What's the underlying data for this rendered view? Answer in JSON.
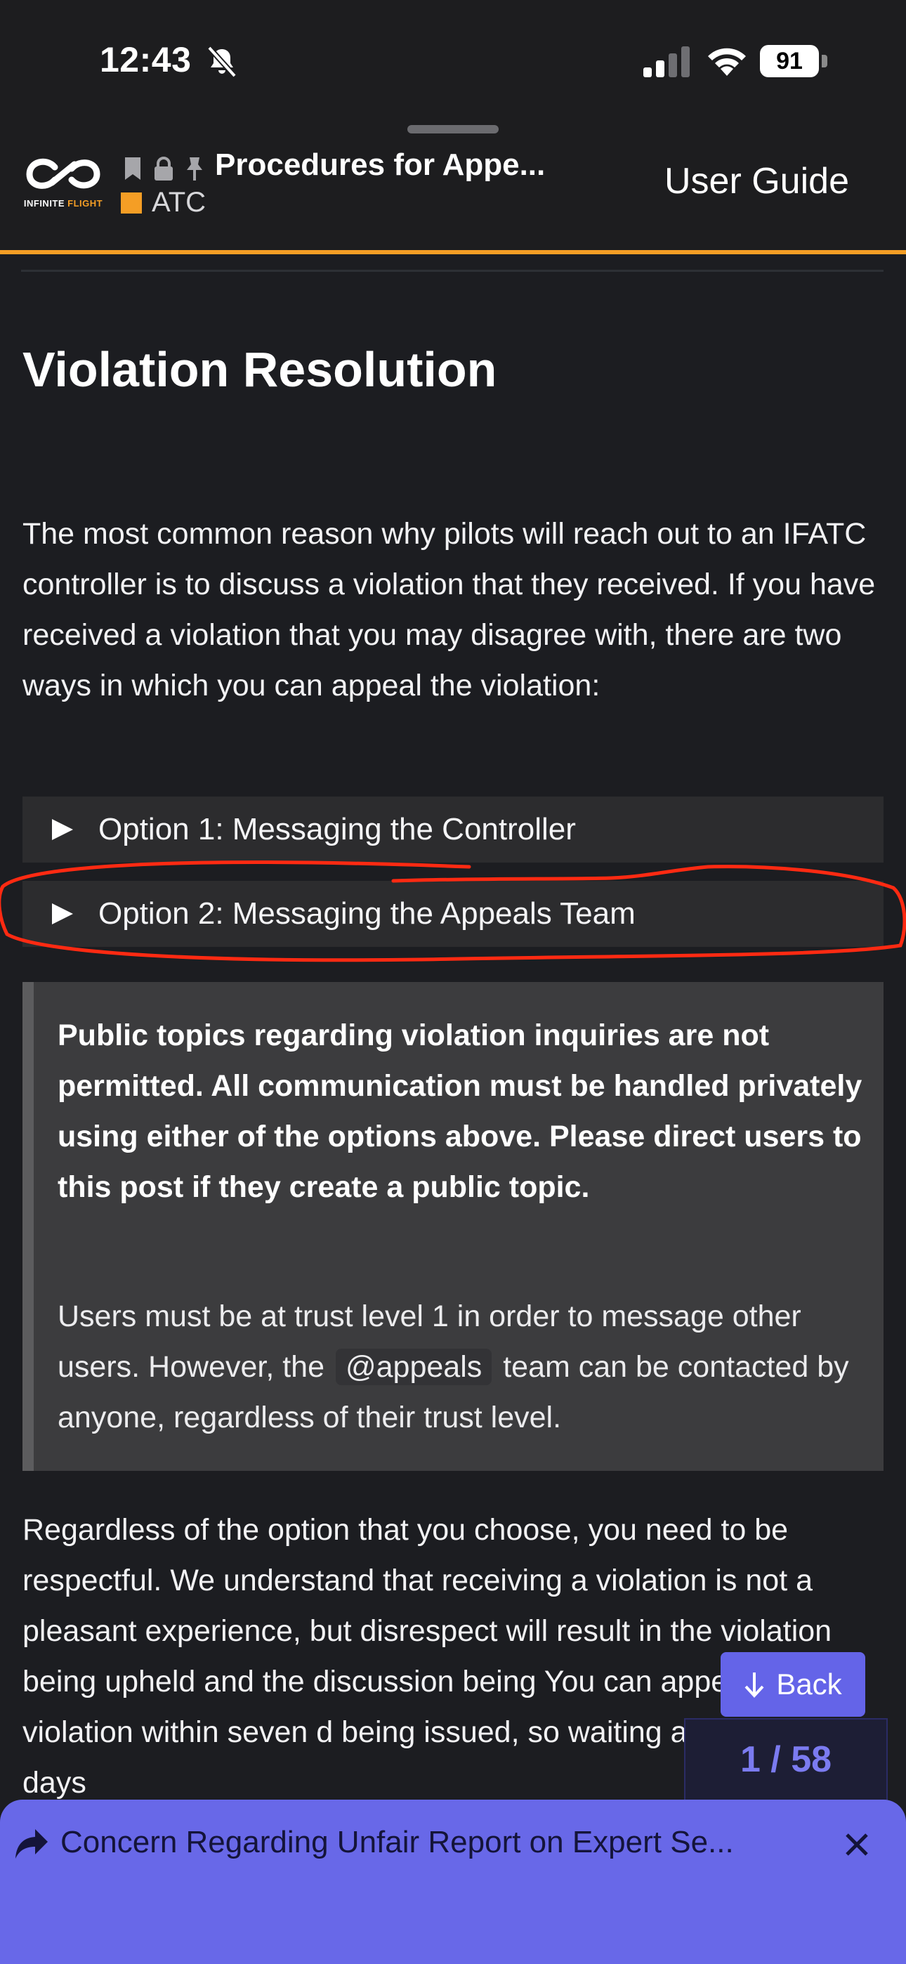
{
  "status_bar": {
    "time": "12:43",
    "battery": "91",
    "icons": [
      "bell-slash-icon",
      "cellular-signal-icon",
      "wifi-icon",
      "battery-icon"
    ]
  },
  "header": {
    "logo": {
      "word": "INFINITE",
      "accent": "FLIGHT",
      "accent_color": "#f59e25"
    },
    "topic_icons": [
      "bookmark-icon",
      "lock-icon",
      "pin-icon"
    ],
    "title": "Procedures for Appe...",
    "category": {
      "name": "ATC",
      "color": "#f59e25"
    },
    "user_guide_label": "User Guide"
  },
  "content": {
    "heading": "Violation Resolution",
    "intro": "The most common reason why pilots will reach out to an IFATC controller is to discuss a violation that they received. If you have received a violation that you may disagree with, there are two ways in which you can appeal the violation:",
    "options": [
      {
        "label": "Option 1: Messaging the Controller"
      },
      {
        "label": "Option 2: Messaging the Appeals Team"
      }
    ],
    "callout": {
      "strong": "Public topics regarding violation inquiries are not permitted. All communication must be handled privately using either of the options above. Please direct users to this post if they create a public topic.",
      "body_before": "Users must be at trust level 1 in order to message other users. However, the",
      "mention": "@appeals",
      "body_after": "team can be contacted by anyone, regardless of their trust level."
    },
    "closing": "Regardless of the option that you choose, you need to be respectful. We understand that receiving a violation is not a pleasant experience, but disrespect will result in the violation being upheld and the discussion being You can appeal your violation within seven d being issued, so waiting a few hours or days"
  },
  "annotation": {
    "color": "#ff2a12"
  },
  "floating": {
    "back_label": "Back",
    "progress": "1 / 58"
  },
  "banner": {
    "text": "Concern Regarding Unfair Report on Expert Se...",
    "color": "#6868e8"
  }
}
